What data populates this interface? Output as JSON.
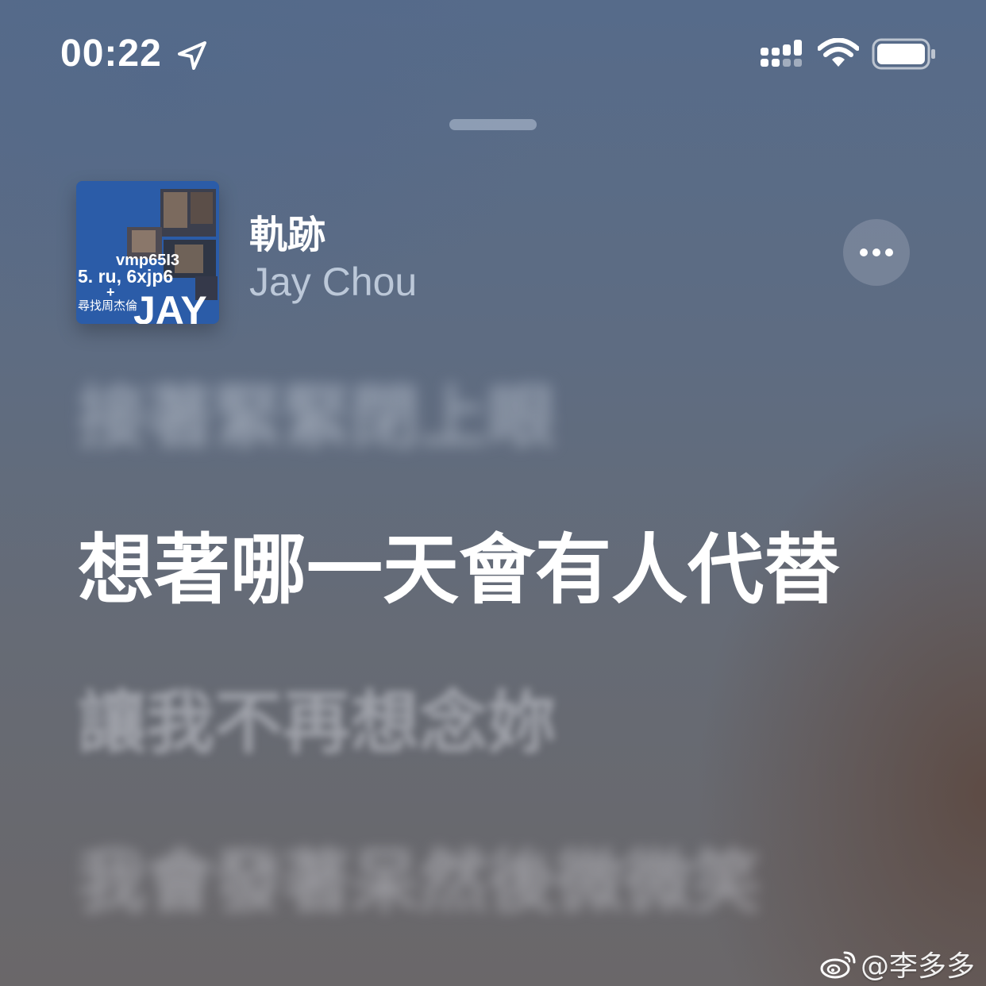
{
  "status_bar": {
    "time": "00:22",
    "location_icon": "location-arrow-icon",
    "signal_icon": "cellular-signal-icon",
    "wifi_icon": "wifi-icon",
    "battery_icon": "battery-icon"
  },
  "now_playing": {
    "title": "軌跡",
    "artist": "Jay Chou",
    "album_art": {
      "text_line1": "vmp65I3",
      "text_line2": "5. ru, 6xjp6",
      "text_line3": "尋找周杰倫",
      "text_brand": "JAY",
      "text_plus": "+"
    },
    "more_icon": "ellipsis-icon"
  },
  "lyrics": {
    "previous": "接著緊緊閉上眼",
    "current": "想著哪一天會有人代替",
    "next": "讓我不再想念妳",
    "after": "我會發著呆然後微微笑"
  },
  "watermark": {
    "icon": "weibo-icon",
    "text": "@李多多"
  },
  "colors": {
    "background_top": "#566b8a",
    "background_bottom": "#6a6769",
    "album_blue": "#2b5ca8",
    "lyric_active": "#ffffff"
  }
}
